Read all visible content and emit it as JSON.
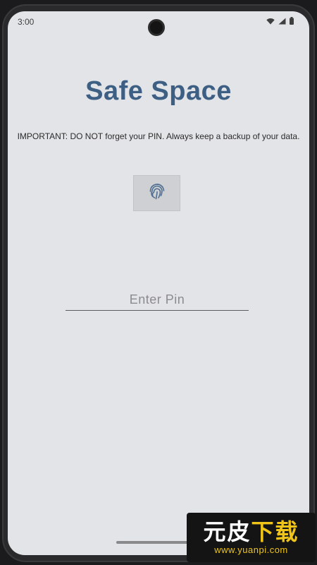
{
  "status_bar": {
    "time": "3:00",
    "icons": [
      "wifi-icon",
      "signal-icon",
      "battery-icon"
    ]
  },
  "app": {
    "title": "Safe Space",
    "warning": "IMPORTANT: DO NOT forget your PIN. Always keep a backup of your data.",
    "fingerprint_icon": "fingerprint-icon",
    "pin_placeholder": "Enter Pin",
    "pin_value": ""
  },
  "watermark": {
    "main_part1": "元皮",
    "main_part2": "下载",
    "sub": "www.yuanpi.com"
  },
  "colors": {
    "title": "#3d5f84",
    "screen_background": "#e3e4e8",
    "button_background": "#cfd0d3",
    "fingerprint": "#4f6f92"
  }
}
